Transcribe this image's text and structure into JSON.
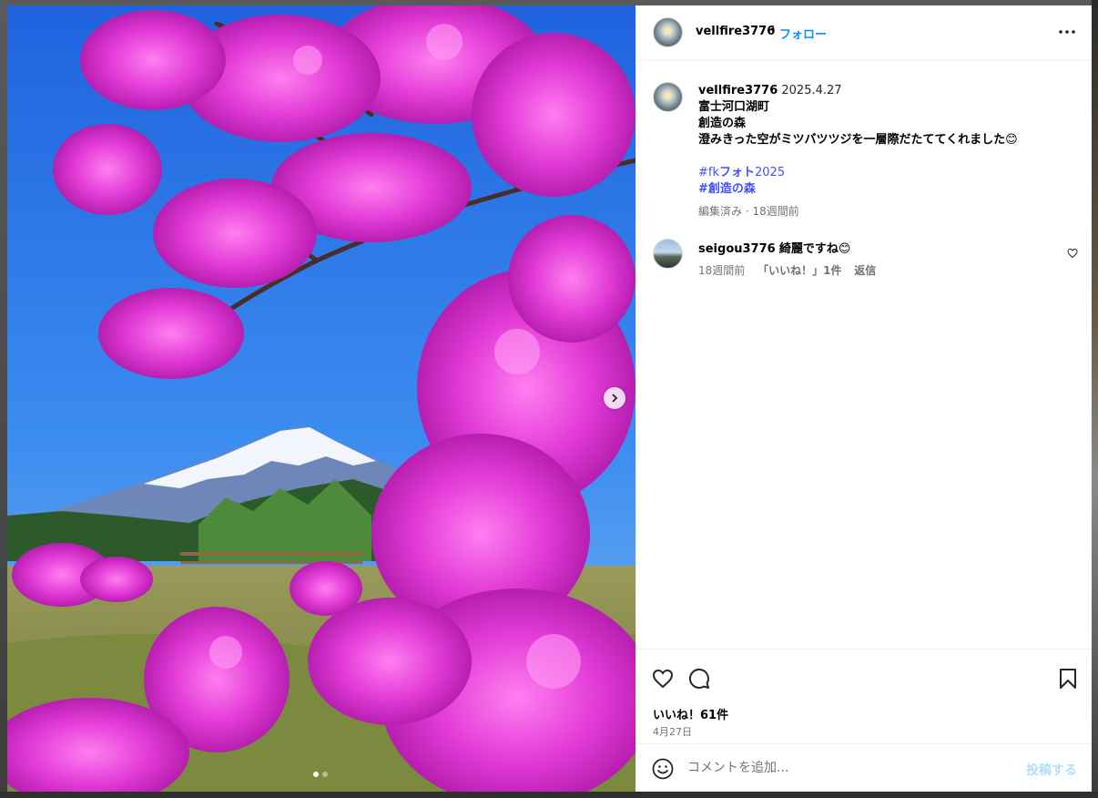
{
  "colors": {
    "accent": "#0095f6",
    "hashtag": "#00376b",
    "hashtag_highlight": "#4150f7",
    "muted": "#737373",
    "post_disabled": "#b2dffc"
  },
  "header": {
    "username": "vellfire3776",
    "separator": "•",
    "follow_label": "フォロー",
    "avatar_icon": "profile-avatar",
    "more_icon": "more-horizontal-icon"
  },
  "photo": {
    "next_icon": "chevron-right-icon",
    "slide_count": 2,
    "active_slide": 1
  },
  "caption": {
    "username": "vellfire3776",
    "date": "2025.4.27",
    "lines": [
      "富士河口湖町",
      "創造の森",
      "澄みきった空がミツバツツジを一層際だたててくれました😊"
    ],
    "hashtags": [
      {
        "prefix": "#fk",
        "highlight": "フォト",
        "suffix": "2025"
      },
      {
        "prefix": "#",
        "highlight": "創造の森",
        "suffix": ""
      }
    ],
    "meta": "編集済み · 18週間前"
  },
  "comments": [
    {
      "username": "seigou3776",
      "text": "綺麗ですね😊",
      "time": "18週間前",
      "likes": "「いいね！」1件",
      "reply": "返信",
      "like_icon": "heart-outline-icon"
    }
  ],
  "actions": {
    "like_icon": "heart-outline-icon",
    "comment_icon": "comment-bubble-icon",
    "save_icon": "bookmark-outline-icon",
    "likes_text": "いいね！61件",
    "date_text": "4月27日"
  },
  "composer": {
    "emoji_icon": "emoji-smile-icon",
    "placeholder": "コメントを追加...",
    "post_label": "投稿する"
  }
}
